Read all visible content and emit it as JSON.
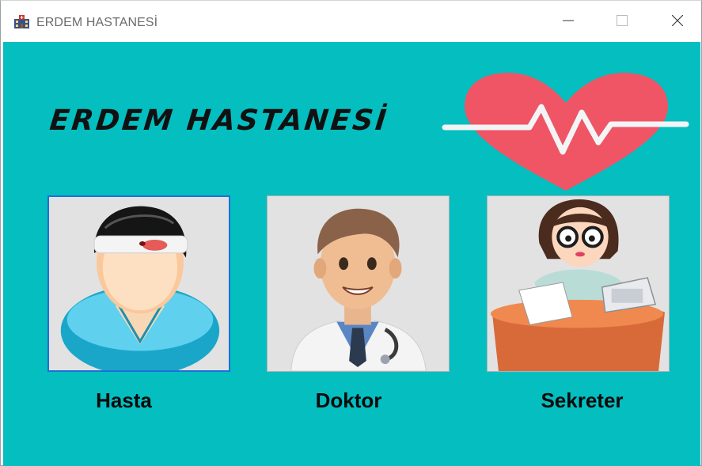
{
  "window": {
    "title": "ERDEM HASTANESİ",
    "controls": [
      "minimize",
      "maximize",
      "close"
    ]
  },
  "header": {
    "heading": "ERDEM HASTANESİ",
    "logo_icon": "heart-pulse-icon"
  },
  "roles": [
    {
      "label": "Hasta",
      "icon": "patient-avatar-icon",
      "selected": true
    },
    {
      "label": "Doktor",
      "icon": "doctor-avatar-icon",
      "selected": false
    },
    {
      "label": "Sekreter",
      "icon": "secretary-avatar-icon",
      "selected": false
    }
  ],
  "colors": {
    "background": "#04bec0",
    "heart": "#ef5565",
    "selection_border": "#1f6fd6"
  }
}
